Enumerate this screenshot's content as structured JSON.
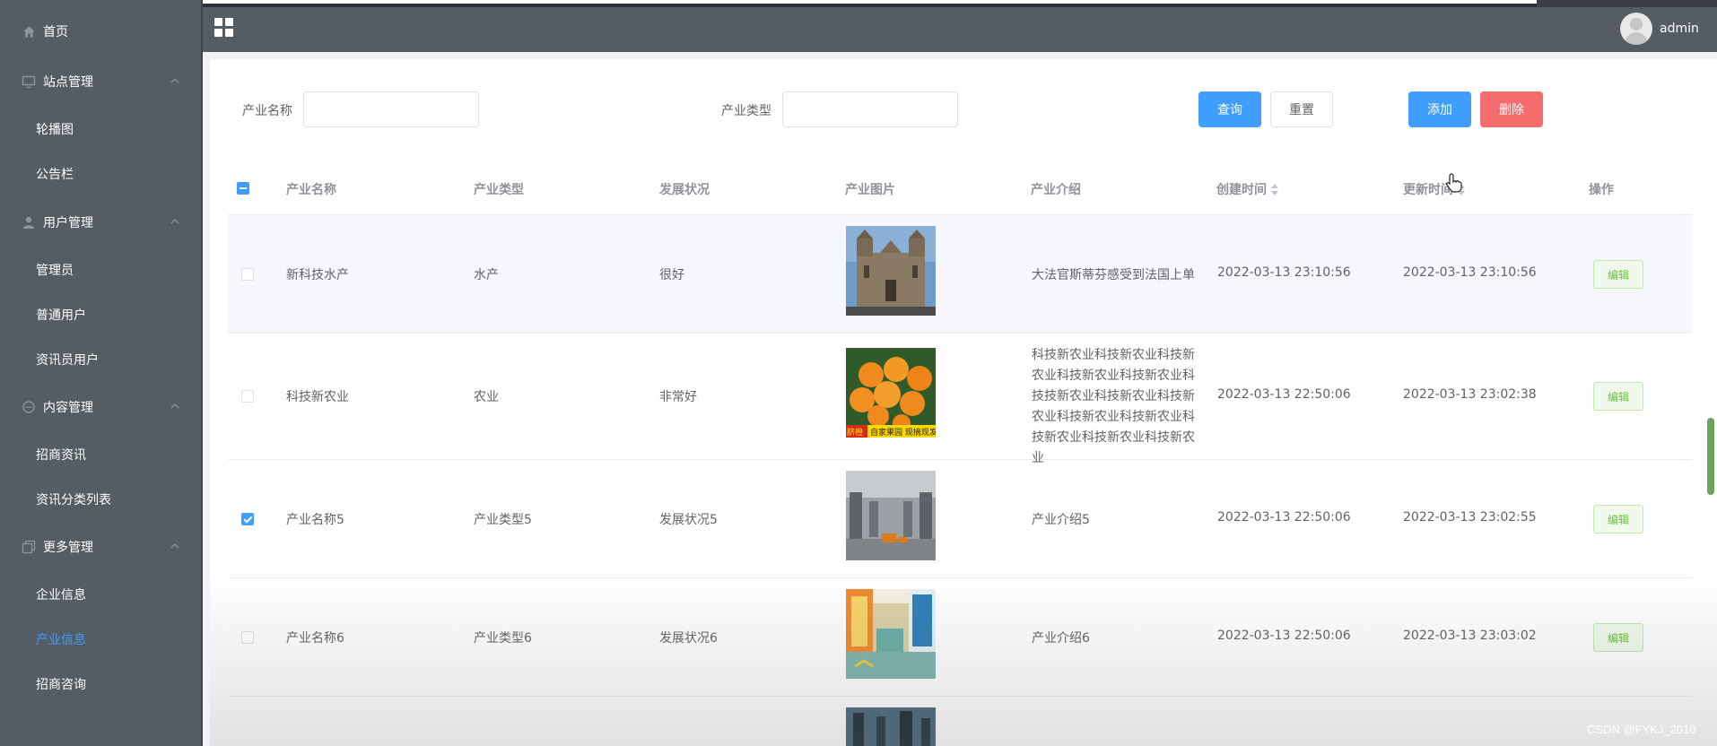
{
  "header": {
    "username": "admin"
  },
  "sidebar": {
    "home": "首页",
    "groups": [
      {
        "label": "站点管理",
        "items": [
          "轮播图",
          "公告栏"
        ]
      },
      {
        "label": "用户管理",
        "items": [
          "管理员",
          "普通用户",
          "资讯员用户"
        ]
      },
      {
        "label": "内容管理",
        "items": [
          "招商资讯",
          "资讯分类列表"
        ]
      },
      {
        "label": "更多管理",
        "items": [
          "企业信息",
          "产业信息",
          "招商咨询"
        ]
      }
    ],
    "active_item": "产业信息"
  },
  "search": {
    "name_label": "产业名称",
    "name_value": "",
    "type_label": "产业类型",
    "type_value": "",
    "query_button": "查询",
    "reset_button": "重置",
    "add_button": "添加",
    "delete_button": "删除"
  },
  "table": {
    "columns": [
      "产业名称",
      "产业类型",
      "发展状况",
      "产业图片",
      "产业介绍",
      "创建时间",
      "更新时间",
      "操作"
    ],
    "rows": [
      {
        "name": "新科技水产",
        "type": "水产",
        "status": "很好",
        "image": "cathedral-photo",
        "intro": "大法官斯蒂芬感受到法国上单",
        "created": "2022-03-13 23:10:56",
        "updated": "2022-03-13 23:10:56",
        "action": "编辑",
        "checked": false
      },
      {
        "name": "科技新农业",
        "type": "农业",
        "status": "非常好",
        "image": "oranges-photo",
        "intro": "科技新农业科技新农业科技新农业科技新农业科技新农业科技技新农业科技新农业科技新农业科技新农业科技新农业科技新农业科技新农业科技新农业",
        "created": "2022-03-13 22:50:06",
        "updated": "2022-03-13 23:02:38",
        "action": "编辑",
        "checked": false,
        "image_caption_a": "自家果园 现摘现发",
        "image_caption_b": "脐橙"
      },
      {
        "name": "产业名称5",
        "type": "产业类型5",
        "status": "发展状况5",
        "image": "warehouse-photo",
        "intro": "产业介绍5",
        "created": "2022-03-13 22:50:06",
        "updated": "2022-03-13 23:02:55",
        "action": "编辑",
        "checked": true
      },
      {
        "name": "产业名称6",
        "type": "产业类型6",
        "status": "发展状况6",
        "image": "interior-photo",
        "intro": "产业介绍6",
        "created": "2022-03-13 22:50:06",
        "updated": "2022-03-13 23:03:02",
        "action": "编辑",
        "checked": false
      }
    ]
  },
  "watermark": "CSDN @FYKJ_2010",
  "colors": {
    "sidebar_bg": "#545c64",
    "primary": "#409eff",
    "danger": "#f56c6c",
    "edit_green": "#67c23a"
  }
}
